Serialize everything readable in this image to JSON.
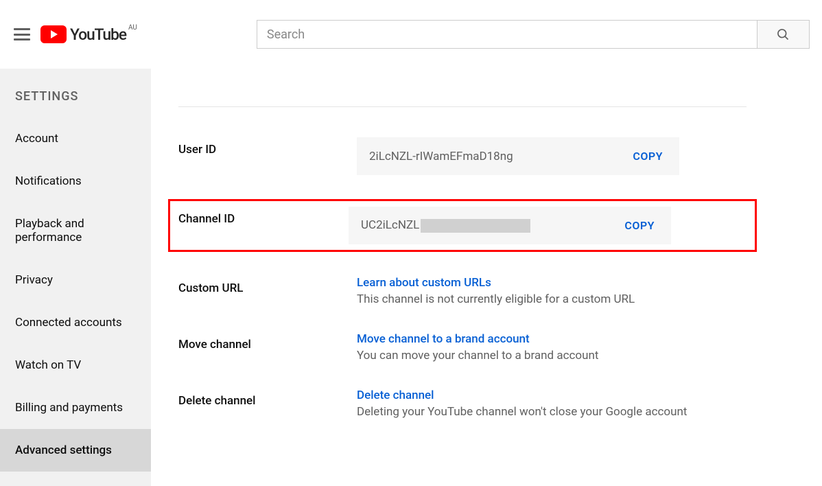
{
  "header": {
    "search_placeholder": "Search",
    "logo_text": "YouTube",
    "logo_region": "AU"
  },
  "sidebar": {
    "title": "SETTINGS",
    "items": [
      {
        "label": "Account"
      },
      {
        "label": "Notifications"
      },
      {
        "label": "Playback and performance"
      },
      {
        "label": "Privacy"
      },
      {
        "label": "Connected accounts"
      },
      {
        "label": "Watch on TV"
      },
      {
        "label": "Billing and payments"
      },
      {
        "label": "Advanced settings"
      }
    ],
    "active_index": 7
  },
  "main": {
    "user_id": {
      "label": "User ID",
      "value": "2iLcNZL-rIWamEFmaD18ng",
      "copy": "COPY"
    },
    "channel_id": {
      "label": "Channel ID",
      "value": "UC2iLcNZL",
      "copy": "COPY"
    },
    "custom_url": {
      "label": "Custom URL",
      "link": "Learn about custom URLs",
      "sub": "This channel is not currently eligible for a custom URL"
    },
    "move_channel": {
      "label": "Move channel",
      "link": "Move channel to a brand account",
      "sub": "You can move your channel to a brand account"
    },
    "delete_channel": {
      "label": "Delete channel",
      "link": "Delete channel",
      "sub": "Deleting your YouTube channel won't close your Google account"
    }
  }
}
